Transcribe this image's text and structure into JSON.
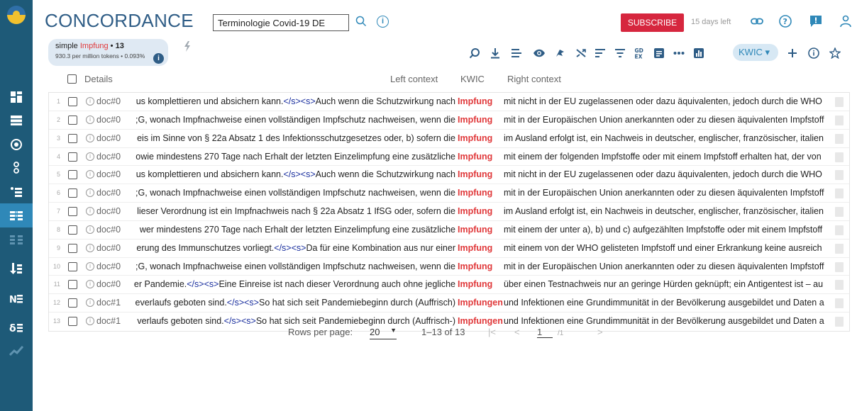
{
  "app": {
    "title": "CONCORDANCE"
  },
  "search": {
    "corpus_value": "Terminologie Covid-19 DE"
  },
  "account": {
    "subscribe_label": "SUBSCRIBE",
    "days_left": "15 days left"
  },
  "query": {
    "type": "simple",
    "keyword": "Impfung",
    "count": "• 13",
    "stats": "930.3 per million tokens • 0.093%"
  },
  "toolbar": {
    "view_label": "KWIC ▾"
  },
  "columns": {
    "details": "Details",
    "left": "Left context",
    "kwic": "KWIC",
    "right": "Right context"
  },
  "rows": [
    {
      "n": "1",
      "doc": "doc#0",
      "left": "us komplettieren und absichern kann.</s><s>Auch wenn die Schutzwirkung nach",
      "kwic": "Impfung",
      "right": "mit nicht in der EU zugelassenen oder dazu äquivalenten, jedoch durch die WHO"
    },
    {
      "n": "2",
      "doc": "doc#0",
      "left": ";G, wonach Impfnachweise einen vollständigen Impfschutz nachweisen, wenn die",
      "kwic": "Impfung",
      "right": "mit in der Europäischen Union anerkannten oder zu diesen äquivalenten Impfstoff"
    },
    {
      "n": "3",
      "doc": "doc#0",
      "left": "eis im Sinne von § 22a Absatz 1 des Infektionsschutzgesetzes oder, b) sofern die",
      "kwic": "Impfung",
      "right": "im Ausland erfolgt ist, ein Nachweis in deutscher, englischer, französischer, italien"
    },
    {
      "n": "4",
      "doc": "doc#0",
      "left": "owie mindestens 270 Tage nach Erhalt der letzten Einzelimpfung eine zusätzliche",
      "kwic": "Impfung",
      "right": "mit einem der folgenden Impfstoffe oder mit einem Impfstoff erhalten hat, der von"
    },
    {
      "n": "5",
      "doc": "doc#0",
      "left": "us komplettieren und absichern kann.</s><s>Auch wenn die Schutzwirkung nach",
      "kwic": "Impfung",
      "right": "mit nicht in der EU zugelassenen oder dazu äquivalenten, jedoch durch die WHO"
    },
    {
      "n": "6",
      "doc": "doc#0",
      "left": ";G, wonach Impfnachweise einen vollständigen Impfschutz nachweisen, wenn die",
      "kwic": "Impfung",
      "right": "mit in der Europäischen Union anerkannten oder zu diesen äquivalenten Impfstoff"
    },
    {
      "n": "7",
      "doc": "doc#0",
      "left": "lieser Verordnung ist ein Impfnachweis nach § 22a Absatz 1 IfSG oder, sofern die",
      "kwic": "Impfung",
      "right": "im Ausland erfolgt ist, ein Nachweis in deutscher, englischer, französischer, italien"
    },
    {
      "n": "8",
      "doc": "doc#0",
      "left": "wer mindestens 270 Tage nach Erhalt der letzten Einzelimpfung eine zusätzliche",
      "kwic": "Impfung",
      "right": "mit einem der unter a), b) und c) aufgezählten Impfstoffe oder mit einem Impfstoff"
    },
    {
      "n": "9",
      "doc": "doc#0",
      "left": "erung des Immunschutzes vorliegt.</s><s>Da für eine Kombination aus nur einer",
      "kwic": "Impfung",
      "right": "mit einem von der WHO gelisteten Impfstoff und einer Erkrankung keine ausreich"
    },
    {
      "n": "10",
      "doc": "doc#0",
      "left": ";G, wonach Impfnachweise einen vollständigen Impfschutz nachweisen, wenn die",
      "kwic": "Impfung",
      "right": "mit in der Europäischen Union anerkannten oder zu diesen äquivalenten Impfstoff"
    },
    {
      "n": "11",
      "doc": "doc#0",
      "left": "er Pandemie.</s><s>Eine Einreise ist nach dieser Verordnung auch ohne jegliche",
      "kwic": "Impfung",
      "right": "über einen Testnachweis nur an geringe Hürden geknüpft; ein Antigentest ist – au"
    },
    {
      "n": "12",
      "doc": "doc#1",
      "left": "everlaufs geboten sind.</s><s>So hat sich seit Pandemiebeginn durch (Auffrisch)",
      "kwic": "Impfungen",
      "right": "und Infektionen eine Grundimmunität in der Bevölkerung ausgebildet und Daten a"
    },
    {
      "n": "13",
      "doc": "doc#1",
      "left": "verlaufs geboten sind.</s><s>So hat sich seit Pandemiebeginn durch (Auffrisch-)",
      "kwic": "Impfungen",
      "right": "und Infektionen eine Grundimmunität in der Bevölkerung ausgebildet und Daten a"
    }
  ],
  "pagination": {
    "rows_per_page_label": "Rows per page:",
    "rows_per_page_value": "20",
    "range": "1–13 of 13",
    "page": "1",
    "total_pages": "/1"
  },
  "colors": {
    "brand": "#1e5a78",
    "accent": "#2f88b8",
    "keyword": "#e0383a",
    "subscribe": "#d6263e"
  }
}
